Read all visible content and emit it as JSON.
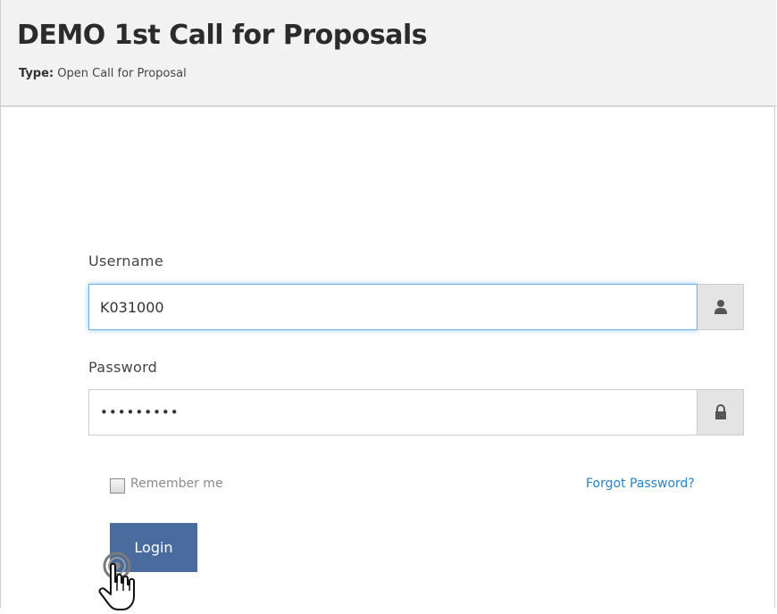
{
  "header": {
    "title": "DEMO 1st Call for Proposals",
    "type_label": "Type:",
    "type_value": "Open Call for Proposal"
  },
  "form": {
    "username_label": "Username",
    "username_value": "K031000",
    "password_label": "Password",
    "password_value": "•••••••••",
    "remember_label": "Remember me",
    "remember_checked": false,
    "forgot_link": "Forgot Password?",
    "login_label": "Login"
  },
  "icons": {
    "username_addon": "user-icon",
    "password_addon": "lock-icon",
    "cursor": "hand-pointer-icon"
  },
  "colors": {
    "header_bg": "#f2f2f2",
    "focus_border": "#66afe9",
    "login_button": "#4a6b9e",
    "link": "#2a7fc1"
  }
}
